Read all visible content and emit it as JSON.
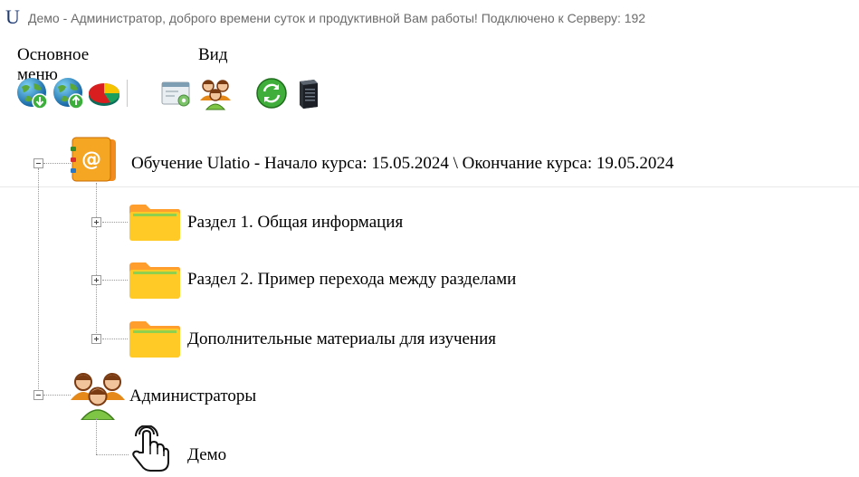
{
  "window": {
    "app_letter": "U",
    "title": "Демо - Администратор, доброго времени суток и продуктивной Вам работы!  Подключено к Серверу: 192"
  },
  "menu": {
    "items": [
      "Основное меню",
      "Вид"
    ]
  },
  "toolbar": {
    "buttons": [
      {
        "icon": "globe-download-icon"
      },
      {
        "icon": "globe-upload-icon"
      },
      {
        "icon": "pie-chart-icon"
      },
      {
        "icon": "settings-window-icon"
      },
      {
        "icon": "users-icon"
      },
      {
        "icon": "refresh-icon"
      },
      {
        "icon": "server-icon"
      }
    ]
  },
  "tree": {
    "course": {
      "label": "Обучение Ulatio - Начало курса: 15.05.2024 \\ Окончание курса: 19.05.2024",
      "icon": "address-book-icon",
      "expanded": true,
      "sections": [
        {
          "label": "Раздел 1. Общая информация",
          "icon": "folder-icon",
          "expanded": false
        },
        {
          "label": "Раздел 2. Пример перехода между разделами",
          "icon": "folder-icon",
          "expanded": false
        },
        {
          "label": "Дополнительные материалы для изучения",
          "icon": "folder-icon",
          "expanded": false
        }
      ]
    },
    "admins": {
      "label": "Администраторы",
      "icon": "users-icon",
      "expanded": true,
      "children": [
        {
          "label": "Демо",
          "icon": "pointer-hand-icon"
        }
      ]
    }
  },
  "colors": {
    "title_text": "#6b6b6b",
    "app_letter": "#1f3b73",
    "folder": "#ffc926",
    "folder_tab": "#ff9d2d",
    "tree_lines": "#9a9a9a"
  }
}
